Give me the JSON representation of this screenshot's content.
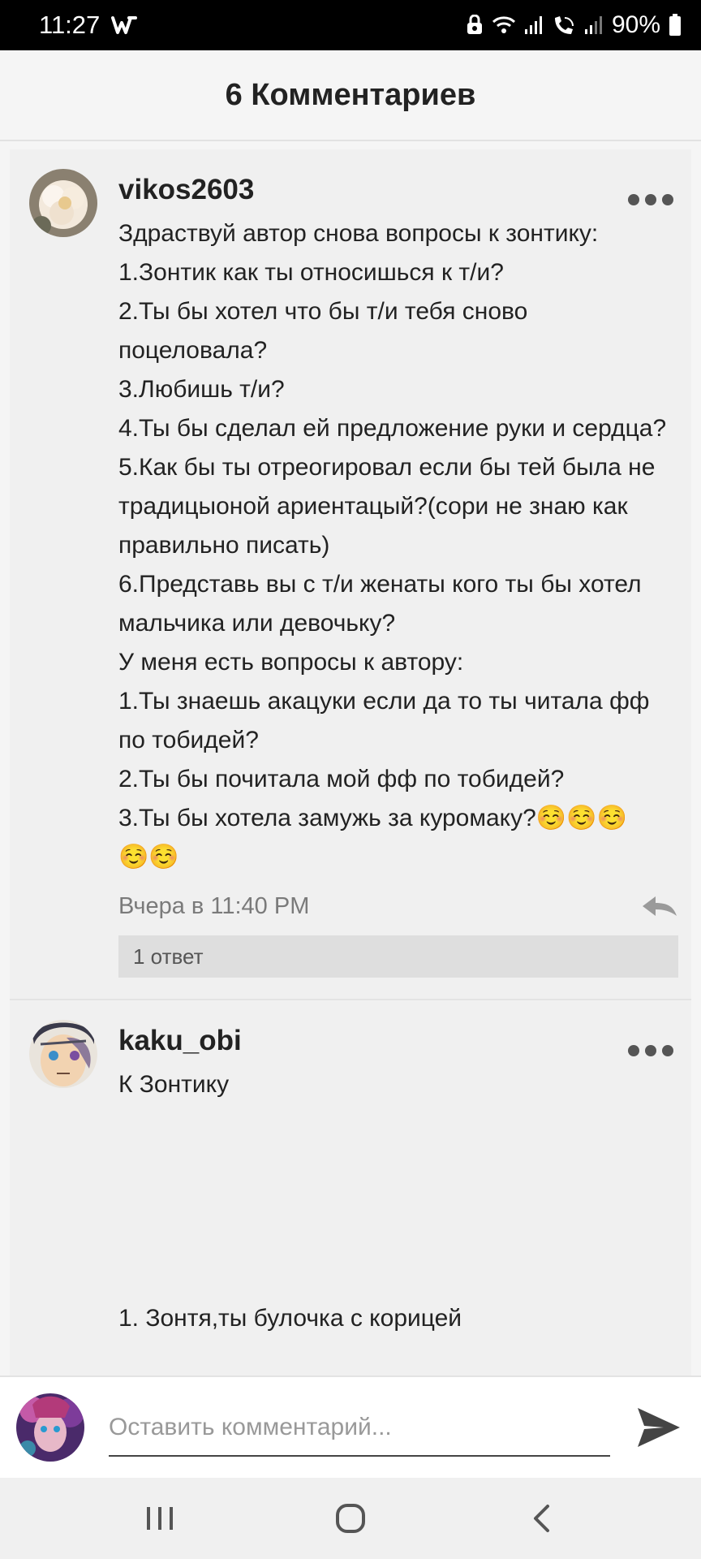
{
  "status_bar": {
    "time": "11:27",
    "app_icon": "wattpad-logo-icon",
    "icons": [
      "vpn-icon",
      "wifi-icon",
      "signal-icon",
      "wifi-calling-icon",
      "signal-2-icon"
    ],
    "battery": "90%"
  },
  "header": {
    "title": "6 Комментариев"
  },
  "comments": [
    {
      "username": "vikos2603",
      "avatar": "rose-avatar",
      "text": "Здраствуй автор снова вопросы к зонтику:\n1.Зонтик как ты относишься к т/и?\n2.Ты бы хотел что бы т/и тебя сново поцеловала?\n3.Любишь т/и?\n4.Ты бы сделал ей предложение руки и сердца?\n5.Как бы ты отреогировал если бы тей была не традицыоной ариентацый?(сори не знаю как правильно писать)\n6.Представь вы с т/и женаты кого ты бы хотел мальчика или девочьку?\nУ меня есть вопросы к автору:\n1.Ты знаешь акацуки если да то ты читала фф по тобидей?\n2.Ты бы почитала мой фф по тобидей?\n3.Ты бы хотела замужь за куромаку?☺️☺️☺️\n☺️☺️",
      "time": "Вчера в 11:40 PM",
      "replies": "1 ответ"
    },
    {
      "username": "kaku_obi",
      "avatar": "anime-character-avatar",
      "text": "К Зонтику\n\n\n\n\n\n1. Зонтя,ты булочка с корицей"
    }
  ],
  "composer": {
    "placeholder": "Оставить комментарий...",
    "send_icon": "send-icon"
  },
  "nav": {
    "icons": [
      "recent-apps-icon",
      "home-icon",
      "back-icon"
    ]
  }
}
